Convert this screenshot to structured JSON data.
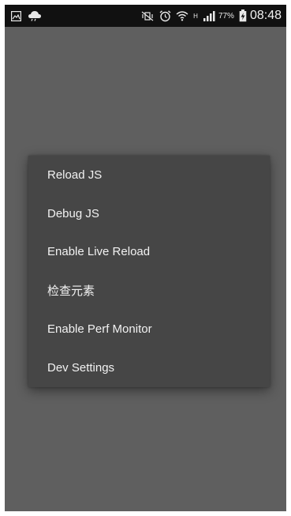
{
  "status_bar": {
    "left_icons": [
      "gallery-notification-icon",
      "weather-cloud-icon"
    ],
    "right_icons": [
      "vibrate-mute-icon",
      "alarm-clock-icon",
      "wifi-icon",
      "signal-icon",
      "battery-charging-icon"
    ],
    "network_type": "H",
    "battery": "77%",
    "time": "08:48"
  },
  "dev_menu": {
    "items": [
      {
        "label": "Reload JS"
      },
      {
        "label": "Debug JS"
      },
      {
        "label": "Enable Live Reload"
      },
      {
        "label": "检查元素"
      },
      {
        "label": "Enable Perf Monitor"
      },
      {
        "label": "Dev Settings"
      }
    ]
  },
  "colors": {
    "background": "#5f5f5f",
    "status_bar": "#111111",
    "menu": "#464646",
    "menu_text": "#f2f2f2"
  }
}
